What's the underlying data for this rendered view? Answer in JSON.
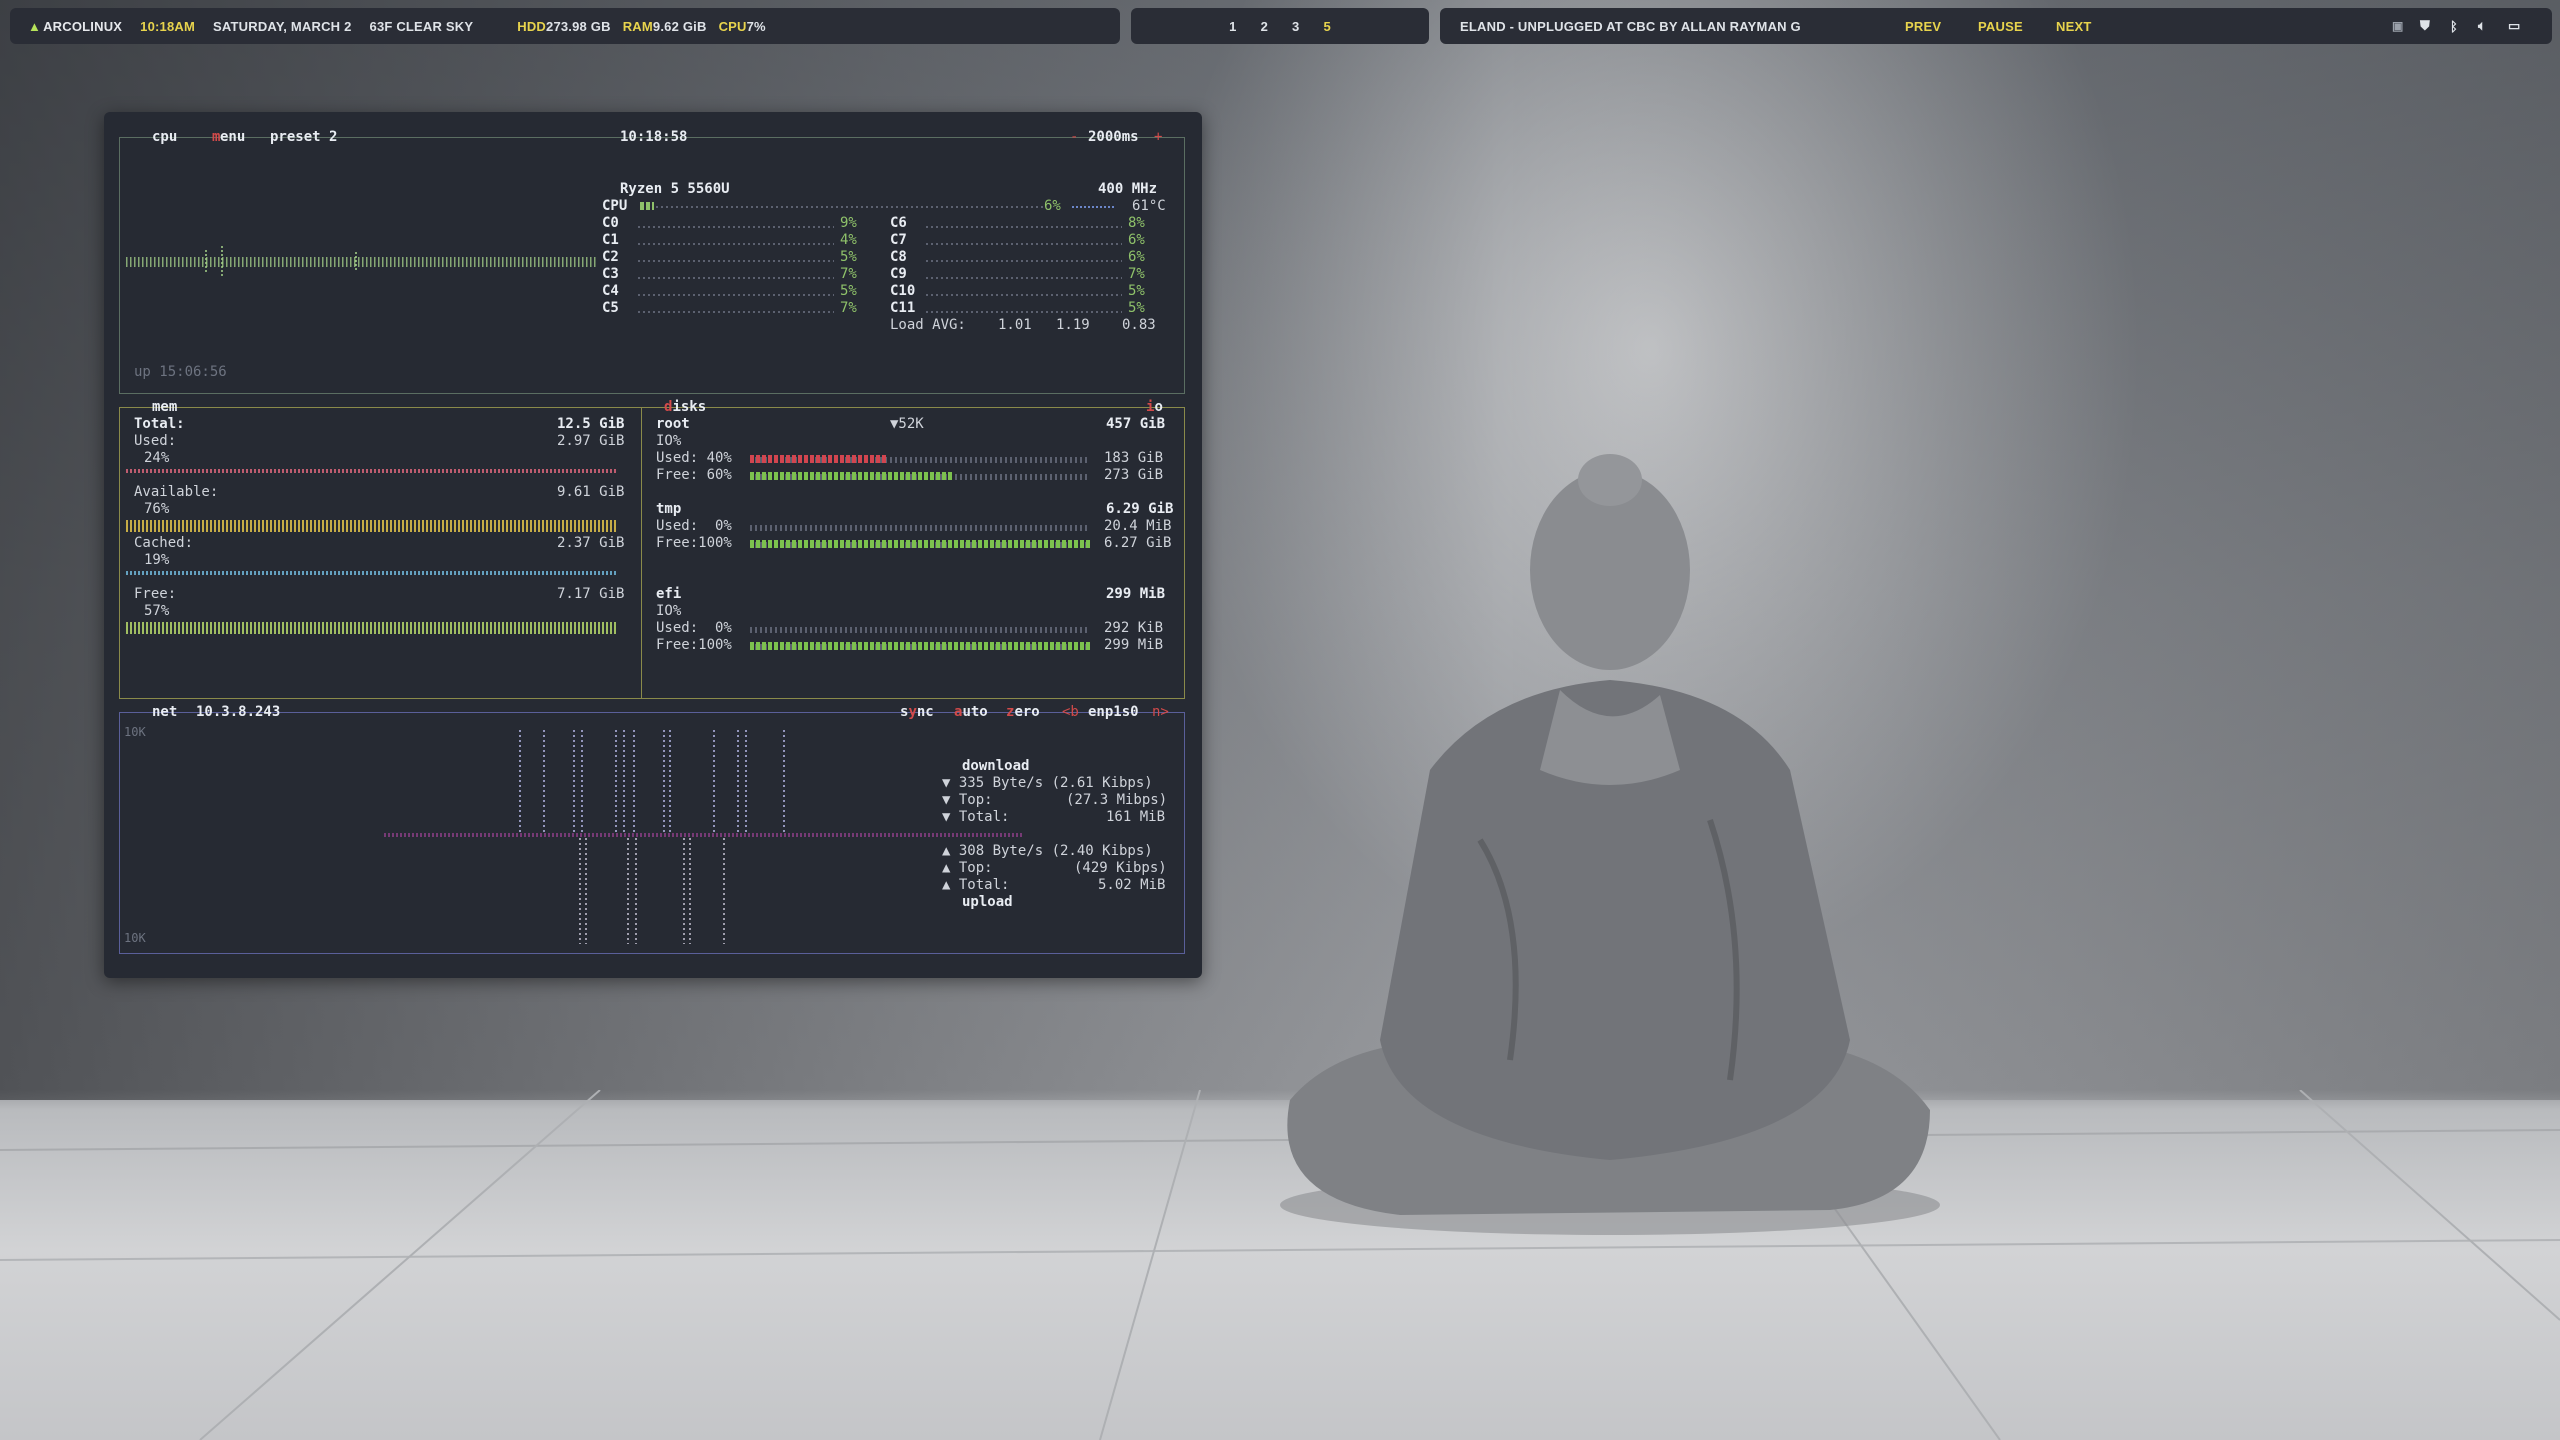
{
  "topbar": {
    "logo": "ARCOLINUX",
    "time": "10:18AM",
    "date": "SATURDAY, MARCH  2",
    "weather": "63F CLEAR SKY",
    "hdd_label": "HDD",
    "hdd_value": "273.98 GB",
    "ram_label": "RAM",
    "ram_value": "9.62 GiB",
    "cpu_label": "CPU",
    "cpu_value": "7%",
    "workspaces": [
      "1",
      "2",
      "3",
      "5"
    ],
    "active_workspace": "5",
    "now_playing": "ELAND - UNPLUGGED AT CBC BY  ALLAN RAYMAN G",
    "prev": "PREV",
    "pause": "PAUSE",
    "next": "NEXT",
    "tray_icons": [
      "app-icon",
      "shield-icon",
      "bluetooth-icon",
      "volume-icon",
      "display-icon"
    ]
  },
  "cpu": {
    "title": "cpu",
    "menu": "menu",
    "preset": "preset 2",
    "clock": "10:18:58",
    "minus": "-",
    "interval": "2000ms",
    "plus": "+",
    "model": "Ryzen 5 5560U",
    "freq": "400 MHz",
    "total_label": "CPU",
    "total_pct": "6%",
    "temp": "61°C",
    "cores_left": [
      {
        "name": "C0",
        "pct": "9%"
      },
      {
        "name": "C1",
        "pct": "4%"
      },
      {
        "name": "C2",
        "pct": "5%"
      },
      {
        "name": "C3",
        "pct": "7%"
      },
      {
        "name": "C4",
        "pct": "5%"
      },
      {
        "name": "C5",
        "pct": "7%"
      }
    ],
    "cores_right": [
      {
        "name": "C6",
        "pct": "8%"
      },
      {
        "name": "C7",
        "pct": "6%"
      },
      {
        "name": "C8",
        "pct": "6%"
      },
      {
        "name": "C9",
        "pct": "7%"
      },
      {
        "name": "C10",
        "pct": "5%"
      },
      {
        "name": "C11",
        "pct": "5%"
      }
    ],
    "load_avg_label": "Load AVG:",
    "load_avg": [
      "1.01",
      "1.19",
      "0.83"
    ],
    "uptime": "up 15:06:56"
  },
  "mem": {
    "title": "mem",
    "total_label": "Total:",
    "total": "12.5 GiB",
    "used_label": "Used:",
    "used": "2.97 GiB",
    "used_pct": "24%",
    "used_frac": 0.24,
    "available_label": "Available:",
    "available": "9.61 GiB",
    "available_pct": "76%",
    "available_frac": 0.76,
    "cached_label": "Cached:",
    "cached": "2.37 GiB",
    "cached_pct": "19%",
    "cached_frac": 0.19,
    "free_label": "Free:",
    "free": "7.17 GiB",
    "free_pct": "57%",
    "free_frac": 0.57
  },
  "disks": {
    "title": "disks",
    "io": "io",
    "list": [
      {
        "name": "root",
        "size": "457 GiB",
        "extra": "▼52K",
        "io": "IO%",
        "used_label": "Used: 40%",
        "used": "183 GiB",
        "used_frac": 0.4,
        "free_label": "Free: 60%",
        "free": "273 GiB",
        "free_frac": 0.6
      },
      {
        "name": "tmp",
        "size": "6.29 GiB",
        "extra": "",
        "io": "",
        "used_label": "Used:  0%",
        "used": "20.4 MiB",
        "used_frac": 0.0,
        "free_label": "Free:100%",
        "free": "6.27 GiB",
        "free_frac": 1.0
      },
      {
        "name": "efi",
        "size": "299 MiB",
        "extra": "",
        "io": "IO%",
        "used_label": "Used:  0%",
        "used": "292 KiB",
        "used_frac": 0.0,
        "free_label": "Free:100%",
        "free": "299 MiB",
        "free_frac": 1.0
      }
    ]
  },
  "net": {
    "title": "net",
    "ip": "10.3.8.243",
    "sync": "sync",
    "auto": "auto",
    "zero": "zero",
    "prev_iface": "<b",
    "iface": "enp1s0",
    "next_iface": "n>",
    "scale_top": "10K",
    "scale_bottom": "10K",
    "download_label": "download",
    "down_rate": "335 Byte/s (2.61 Kibps)",
    "down_top_label": "Top:",
    "down_top": "(27.3 Mibps)",
    "down_total_label": "Total:",
    "down_total": "161 MiB",
    "up_rate": "308 Byte/s (2.40 Kibps)",
    "up_top_label": "Top:",
    "up_top": "(429 Kibps)",
    "up_total_label": "Total:",
    "up_total": "5.02 MiB",
    "upload_label": "upload"
  }
}
